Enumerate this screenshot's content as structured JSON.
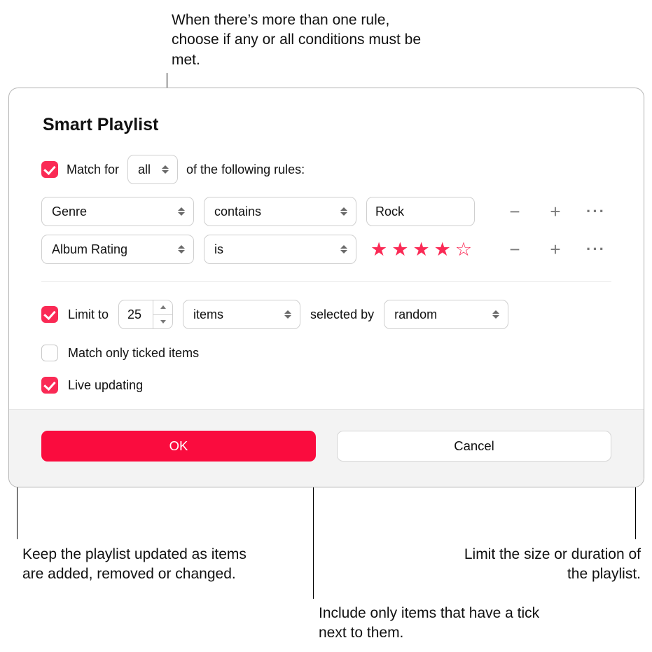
{
  "dialog": {
    "title": "Smart Playlist",
    "match": {
      "checked": true,
      "prefix": "Match for",
      "mode": "all",
      "suffix": "of the following rules:"
    },
    "rules": [
      {
        "field": "Genre",
        "operator": "contains",
        "value_text": "Rock",
        "rating": null
      },
      {
        "field": "Album Rating",
        "operator": "is",
        "value_text": null,
        "rating": 4
      }
    ],
    "limit": {
      "checked": true,
      "label": "Limit to",
      "count": "25",
      "unit": "items",
      "selected_by_label": "selected by",
      "selected_by": "random"
    },
    "match_ticked": {
      "checked": false,
      "label": "Match only ticked items"
    },
    "live_updating": {
      "checked": true,
      "label": "Live updating"
    },
    "buttons": {
      "ok": "OK",
      "cancel": "Cancel"
    }
  },
  "callouts": {
    "top": "When there’s more than one rule, choose if any or all conditions must be met.",
    "left": "Keep the playlist updated as items are added, removed or changed.",
    "middle": "Include only items that have a tick next to them.",
    "right": "Limit the size or duration of the playlist."
  }
}
